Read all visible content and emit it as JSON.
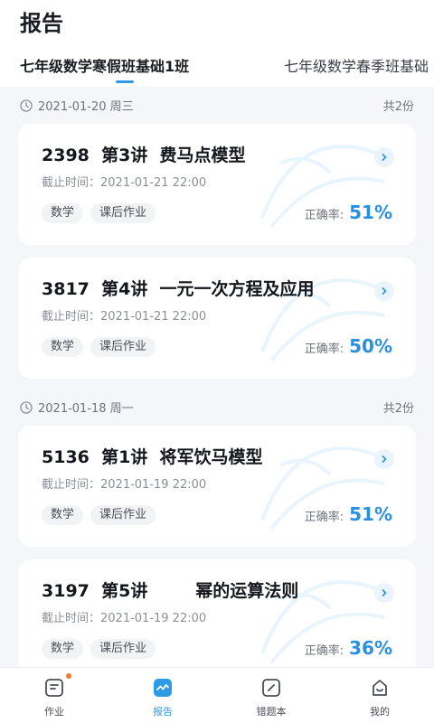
{
  "page": {
    "title": "报告"
  },
  "tabs": [
    {
      "label": "七年级数学寒假班基础1班"
    },
    {
      "label": "七年级数学春季班基础"
    }
  ],
  "groups": [
    {
      "date": "2021-01-20  周三",
      "count": "共2份",
      "cards": [
        {
          "title": "2398  第3讲  费马点模型",
          "deadline": "截止时间：2021-01-21 22:00",
          "tags": [
            "数学",
            "课后作业"
          ],
          "accuracy_label": "正确率:",
          "accuracy": "51%"
        },
        {
          "title": "3817  第4讲  一元一次方程及应用",
          "deadline": "截止时间：2021-01-21 22:00",
          "tags": [
            "数学",
            "课后作业"
          ],
          "accuracy_label": "正确率:",
          "accuracy": "50%"
        }
      ]
    },
    {
      "date": "2021-01-18  周一",
      "count": "共2份",
      "cards": [
        {
          "title": "5136  第1讲  将军饮马模型",
          "deadline": "截止时间：2021-01-19 22:00",
          "tags": [
            "数学",
            "课后作业"
          ],
          "accuracy_label": "正确率:",
          "accuracy": "51%"
        },
        {
          "title": "3197  第5讲        幂的运算法则",
          "deadline": "截止时间：2021-01-19 22:00",
          "tags": [
            "数学",
            "课后作业"
          ],
          "accuracy_label": "正确率:",
          "accuracy": "36%"
        }
      ]
    }
  ],
  "bottom_nav": [
    {
      "label": "作业",
      "icon": "homework-icon"
    },
    {
      "label": "报告",
      "icon": "report-icon"
    },
    {
      "label": "错题本",
      "icon": "mistake-book-icon"
    },
    {
      "label": "我的",
      "icon": "profile-icon"
    }
  ],
  "colors": {
    "accent": "#2f9ae6",
    "accuracy": "#2a8fe0",
    "badge": "#f07a2a"
  }
}
